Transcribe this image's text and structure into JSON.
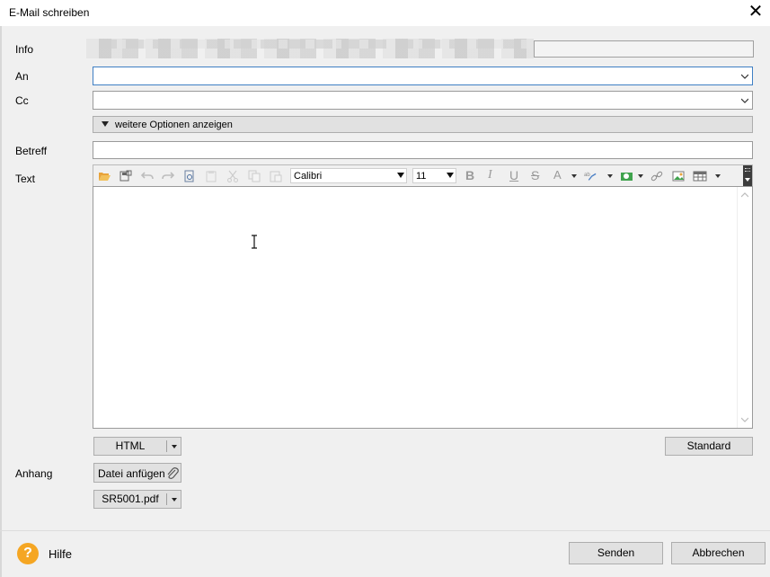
{
  "window": {
    "title": "E-Mail schreiben",
    "close_glyph": "✕"
  },
  "form": {
    "info_label": "Info",
    "to_label": "An",
    "to_value": "",
    "cc_label": "Cc",
    "cc_value": "",
    "more_options_label": "weitere Optionen anzeigen",
    "subject_label": "Betreff",
    "subject_value": "",
    "text_label": "Text"
  },
  "toolbar": {
    "font_name": "Calibri",
    "font_size": "11",
    "bold": "B",
    "italic": "I",
    "underline": "U",
    "strike": "S",
    "font_color": "A"
  },
  "editor": {
    "content": ""
  },
  "format_select": {
    "value": "HTML"
  },
  "standard_button": "Standard",
  "attachments": {
    "label": "Anhang",
    "attach_button": "Datei anfügen",
    "files": [
      "SR5001.pdf"
    ]
  },
  "footer": {
    "help_glyph": "?",
    "help_label": "Hilfe",
    "send_button": "Senden",
    "cancel_button": "Abbrechen"
  },
  "colors": {
    "accent_focus": "#3f7fc4",
    "help_orange": "#f5a623",
    "folder_orange": "#e8a33a"
  }
}
